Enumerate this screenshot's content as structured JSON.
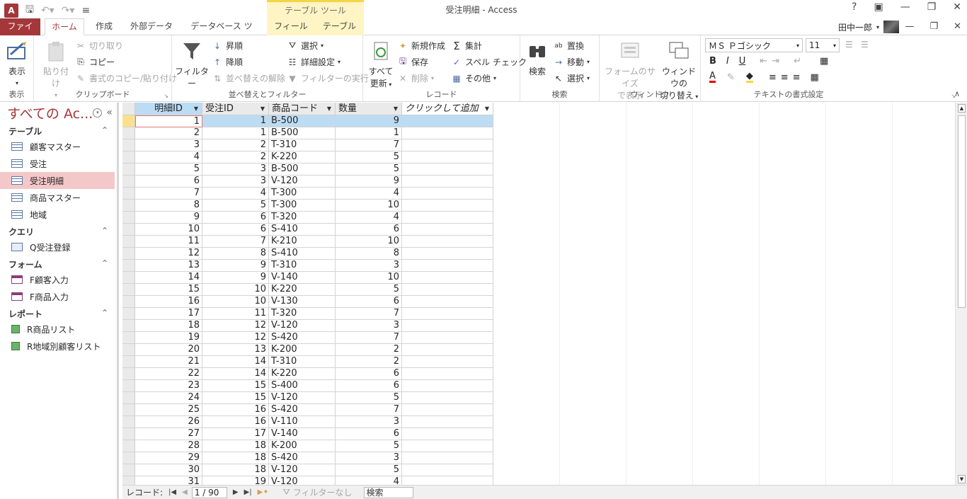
{
  "window": {
    "title": "受注明細 - Access",
    "context_tab_group": "テーブル ツール",
    "user": "田中一郎",
    "help": "?"
  },
  "tabs": [
    "ファイル",
    "ホーム",
    "作成",
    "外部データ",
    "データベース ツール",
    "フィールド",
    "テーブル"
  ],
  "ribbon": {
    "views": {
      "label": "表示",
      "group": "表示"
    },
    "clipboard": {
      "paste": "貼り付け",
      "cut": "切り取り",
      "copy": "コピー",
      "format_painter": "書式のコピー/貼り付け",
      "group": "クリップボード"
    },
    "sort_filter": {
      "filter": "フィルター",
      "ascending": "昇順",
      "descending": "降順",
      "remove_sort": "並べ替えの解除",
      "selection": "選択",
      "advanced": "詳細設定",
      "toggle_filter": "フィルターの実行",
      "group": "並べ替えとフィルター"
    },
    "records": {
      "refresh_line1": "すべて",
      "refresh_line2": "更新",
      "new": "新規作成",
      "save": "保存",
      "delete": "削除",
      "totals": "集計",
      "spelling": "スペル チェック",
      "more": "その他",
      "group": "レコード"
    },
    "find": {
      "find": "検索",
      "replace": "置換",
      "goto": "移動",
      "select": "選択",
      "group": "検索"
    },
    "window": {
      "fit_line1": "フォームのサイズ",
      "fit_line2": "で表示",
      "switch_line1": "ウィンドウの",
      "switch_line2": "切り替え",
      "group": "ウィンドウ"
    },
    "text_format": {
      "font": "ＭＳ Ｐゴシック",
      "size": "11",
      "group": "テキストの書式設定"
    }
  },
  "nav": {
    "title": "すべての Ac...",
    "sections": [
      {
        "label": "テーブル",
        "items": [
          "顧客マスター",
          "受注",
          "受注明細",
          "商品マスター",
          "地域"
        ]
      },
      {
        "label": "クエリ",
        "items": [
          "Q受注登録"
        ]
      },
      {
        "label": "フォーム",
        "items": [
          "F顧客入力",
          "F商品入力"
        ]
      },
      {
        "label": "レポート",
        "items": [
          "R商品リスト",
          "R地域別顧客リスト"
        ]
      }
    ],
    "selected": "受注明細"
  },
  "datasheet": {
    "columns": [
      "明細ID",
      "受注ID",
      "商品コード",
      "数量",
      "クリックして追加"
    ],
    "rows": [
      [
        "1",
        "1",
        "B-500",
        "9"
      ],
      [
        "2",
        "1",
        "B-500",
        "1"
      ],
      [
        "3",
        "2",
        "T-310",
        "7"
      ],
      [
        "4",
        "2",
        "K-220",
        "5"
      ],
      [
        "5",
        "3",
        "B-500",
        "5"
      ],
      [
        "6",
        "3",
        "V-120",
        "9"
      ],
      [
        "7",
        "4",
        "T-300",
        "4"
      ],
      [
        "8",
        "5",
        "T-300",
        "10"
      ],
      [
        "9",
        "6",
        "T-320",
        "4"
      ],
      [
        "10",
        "6",
        "S-410",
        "6"
      ],
      [
        "11",
        "7",
        "K-210",
        "10"
      ],
      [
        "12",
        "8",
        "S-410",
        "8"
      ],
      [
        "13",
        "9",
        "T-310",
        "3"
      ],
      [
        "14",
        "9",
        "V-140",
        "10"
      ],
      [
        "15",
        "10",
        "K-220",
        "5"
      ],
      [
        "16",
        "10",
        "V-130",
        "6"
      ],
      [
        "17",
        "11",
        "T-320",
        "7"
      ],
      [
        "18",
        "12",
        "V-120",
        "3"
      ],
      [
        "19",
        "12",
        "S-420",
        "7"
      ],
      [
        "20",
        "13",
        "K-200",
        "2"
      ],
      [
        "21",
        "14",
        "T-310",
        "2"
      ],
      [
        "22",
        "14",
        "K-220",
        "6"
      ],
      [
        "23",
        "15",
        "S-400",
        "6"
      ],
      [
        "24",
        "15",
        "V-120",
        "5"
      ],
      [
        "25",
        "16",
        "S-420",
        "7"
      ],
      [
        "26",
        "16",
        "V-110",
        "3"
      ],
      [
        "27",
        "17",
        "V-140",
        "6"
      ],
      [
        "28",
        "18",
        "K-200",
        "5"
      ],
      [
        "29",
        "18",
        "S-420",
        "3"
      ],
      [
        "30",
        "18",
        "V-120",
        "5"
      ],
      [
        "31",
        "19",
        "V-120",
        "4"
      ]
    ]
  },
  "record_bar": {
    "label": "レコード:",
    "position": "1 / 90",
    "filter": "フィルターなし",
    "search": "検索"
  },
  "colors": {
    "accent": "#a4373a",
    "selected_nav": "#f4c7c9",
    "current_row": "#bcdcf4",
    "context_tab": "#fff4c4"
  }
}
